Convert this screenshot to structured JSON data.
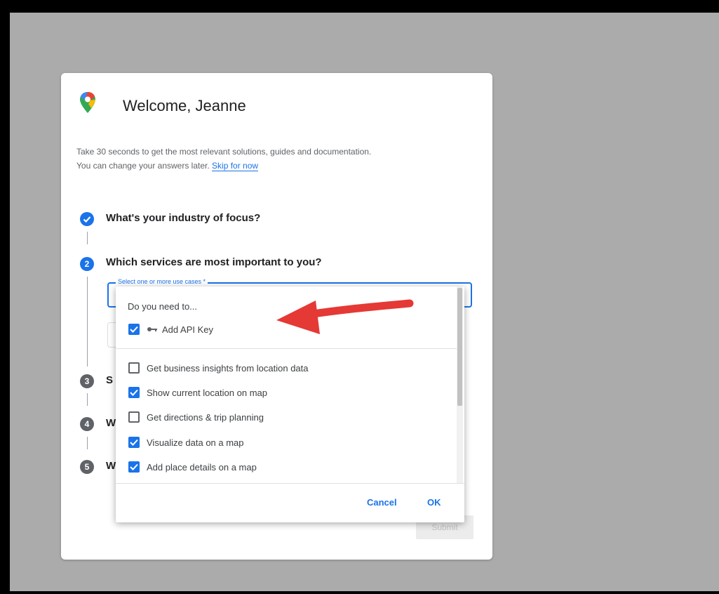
{
  "welcome": {
    "title": "Welcome, Jeanne",
    "intro_line1": "Take 30 seconds to get the most relevant solutions, guides and documentation.",
    "intro_line2": "You can change your answers later.",
    "skip_link": "Skip for now"
  },
  "logo": "google-maps-pin-logo",
  "steps": [
    {
      "number": "1",
      "status": "done",
      "label": "What's your industry of focus?"
    },
    {
      "number": "2",
      "status": "active",
      "label": "Which services are most important to you?"
    },
    {
      "number": "3",
      "status": "todo",
      "label": "S"
    },
    {
      "number": "4",
      "status": "todo",
      "label": "W"
    },
    {
      "number": "5",
      "status": "todo",
      "label": "W"
    }
  ],
  "select": {
    "legend": "Select one or more use cases *"
  },
  "dropdown": {
    "heading": "Do you need to...",
    "key_option": {
      "label": "Add API Key",
      "checked": true,
      "icon": "key-icon"
    },
    "options": [
      {
        "label": "Get business insights from location data",
        "checked": false
      },
      {
        "label": "Show current location on map",
        "checked": true
      },
      {
        "label": "Get directions & trip planning",
        "checked": false
      },
      {
        "label": "Visualize data on a map",
        "checked": true
      },
      {
        "label": "Add place details on a map",
        "checked": true
      }
    ],
    "cancel_label": "Cancel",
    "ok_label": "OK"
  },
  "submit_label": "Submit",
  "colors": {
    "accent": "#1a73e8",
    "annotation_arrow": "#e53935",
    "backdrop": "#ababab"
  }
}
